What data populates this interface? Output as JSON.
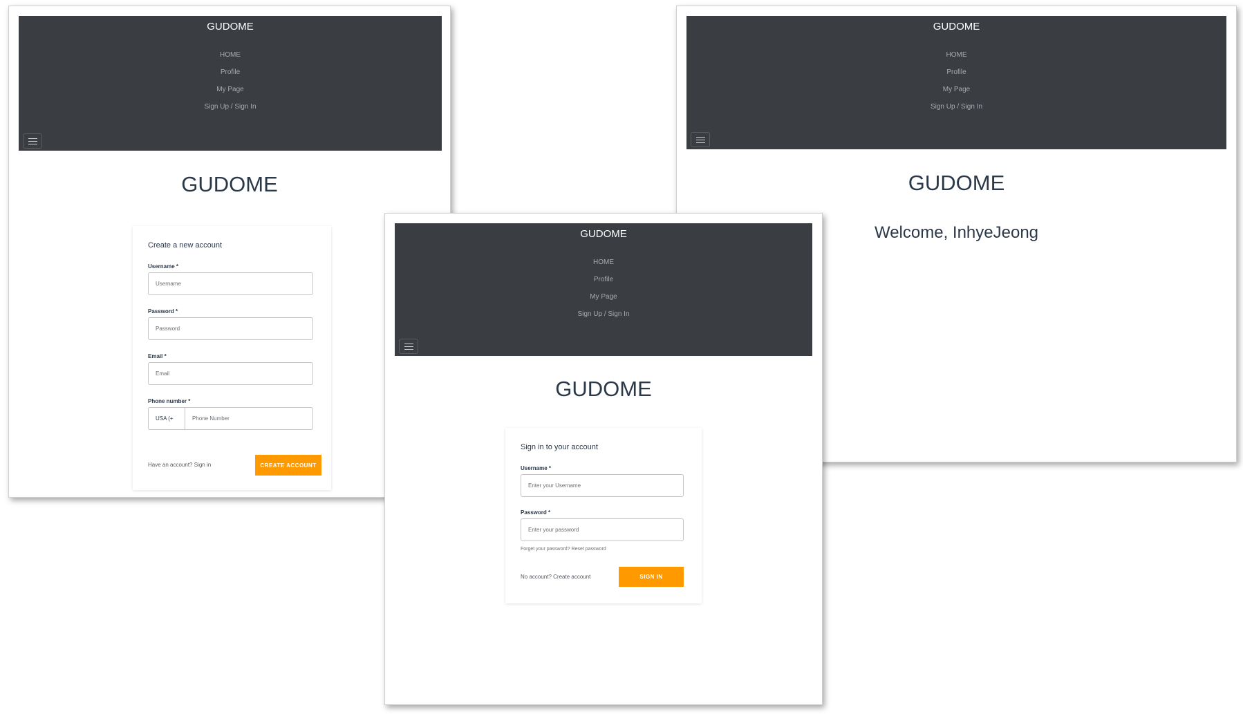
{
  "nav": {
    "brand": "GUDOME",
    "links": [
      "HOME",
      "Profile",
      "My Page",
      "Sign Up / Sign In"
    ]
  },
  "page_title": "GUDOME",
  "signup": {
    "title": "Create a new account",
    "username_label": "Username *",
    "username_placeholder": "Username",
    "password_label": "Password *",
    "password_placeholder": "Password",
    "email_label": "Email *",
    "email_placeholder": "Email",
    "phone_label": "Phone number *",
    "country_code": "USA (+",
    "phone_placeholder": "Phone Number",
    "signin_prompt": "Have an account? Sign in",
    "submit_label": "CREATE ACCOUNT"
  },
  "signin": {
    "title": "Sign in to your account",
    "username_label": "Username *",
    "username_placeholder": "Enter your Username",
    "password_label": "Password *",
    "password_placeholder": "Enter your password",
    "reset_prompt": "Forget your password? Reset password",
    "create_prompt": "No account? Create account",
    "submit_label": "SIGN IN"
  },
  "home": {
    "welcome": "Welcome, InhyeJeong"
  },
  "colors": {
    "navbar_bg": "#3a3e43",
    "accent": "#ff9900",
    "heading": "#2b3848"
  }
}
